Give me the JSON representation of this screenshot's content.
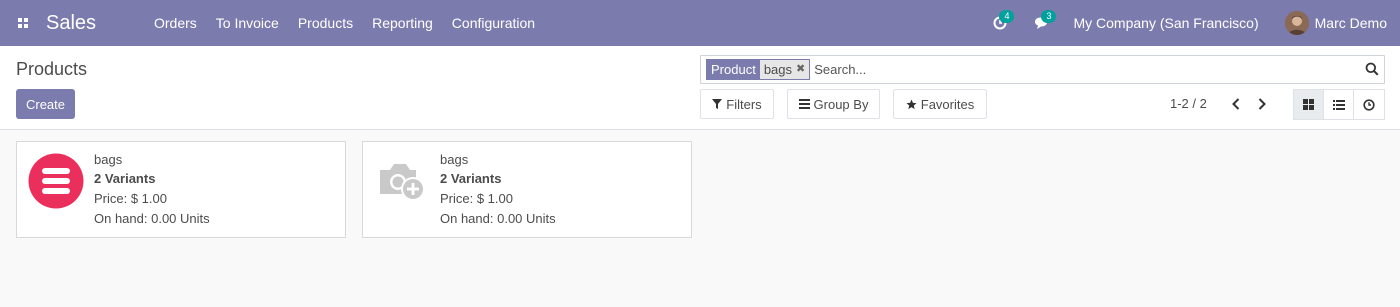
{
  "navbar": {
    "app_name": "Sales",
    "menu": [
      "Orders",
      "To Invoice",
      "Products",
      "Reporting",
      "Configuration"
    ],
    "activity_count": "4",
    "messages_count": "3",
    "company": "My Company (San Francisco)",
    "user": "Marc Demo",
    "colors": {
      "navbar_bg": "#7c7bad",
      "badge_bg": "#00a09d"
    }
  },
  "control_panel": {
    "title": "Products",
    "create_label": "Create",
    "search": {
      "facet_label": "Product",
      "facet_value": "bags",
      "placeholder": "Search..."
    },
    "filters_label": "Filters",
    "group_by_label": "Group By",
    "favorites_label": "Favorites",
    "pager_value": "1-2 / 2",
    "views": [
      "kanban-icon",
      "list-icon",
      "activity-icon"
    ],
    "active_view": "kanban"
  },
  "kanban": {
    "cards": [
      {
        "name": "bags",
        "variants": "2 Variants",
        "price": "Price: $ 1.00",
        "on_hand": "On hand: 0.00 Units",
        "image_icon": "product-logo-icon"
      },
      {
        "name": "bags",
        "variants": "2 Variants",
        "price": "Price: $ 1.00",
        "on_hand": "On hand: 0.00 Units",
        "image_icon": "camera-placeholder-icon"
      }
    ]
  }
}
